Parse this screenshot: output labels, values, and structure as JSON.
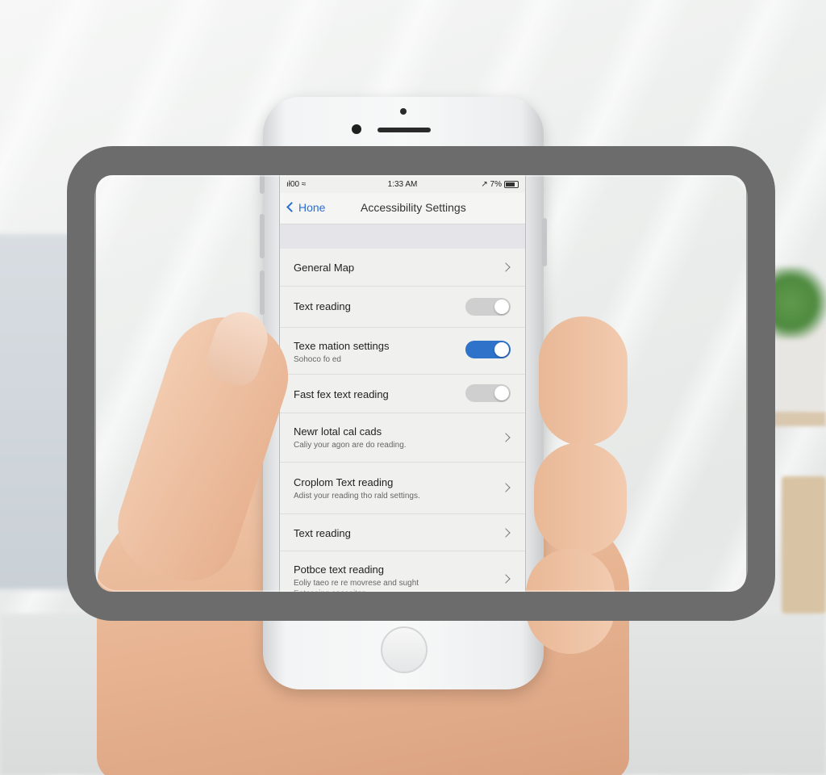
{
  "status_bar": {
    "left": "ıł00 ≈",
    "time": "1:33 AM",
    "right": "↗ 7%"
  },
  "nav": {
    "back_label": "Hone",
    "title": "Accessibility Settings"
  },
  "rows": [
    {
      "label": "General Map",
      "sub": "",
      "control": "chevron"
    },
    {
      "label": "Text reading",
      "sub": "",
      "control": "toggle-off"
    },
    {
      "label": "Texe mation settings",
      "sub": "Sohoco fo ed",
      "control": "toggle-on"
    },
    {
      "label": "Fast fex text reading",
      "sub": "",
      "control": "toggle-off"
    },
    {
      "label": "Newr lotal cal cads",
      "sub": "Caliy your agon are do reading.",
      "control": "chevron"
    },
    {
      "label": "Croplom Text reading",
      "sub": "Adist your reading tho rald settings.",
      "control": "chevron"
    },
    {
      "label": "Text reading",
      "sub": "",
      "control": "chevron"
    },
    {
      "label": "Potbce text reading",
      "sub": "Eoliy taeo re re movrese and sught",
      "sub2": "Eotosaing soosaiton",
      "control": "chevron"
    }
  ],
  "colors": {
    "accent": "#2f72c9",
    "frame": "#6c6c6c",
    "toggle_off": "#cfcfcf"
  }
}
